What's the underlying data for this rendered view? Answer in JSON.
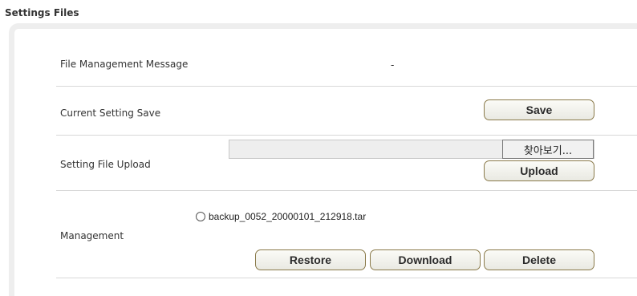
{
  "section_title": "Settings Files",
  "rows": {
    "message": {
      "label": "File Management Message",
      "value": "-"
    },
    "save": {
      "label": "Current Setting Save",
      "button": "Save"
    },
    "upload": {
      "label": "Setting File Upload",
      "browse_button": "찾아보기...",
      "upload_button": "Upload"
    },
    "management": {
      "label": "Management",
      "backup_file": "backup_0052_20000101_212918.tar",
      "backup_selected": false,
      "restore_button": "Restore",
      "download_button": "Download",
      "delete_button": "Delete"
    }
  }
}
